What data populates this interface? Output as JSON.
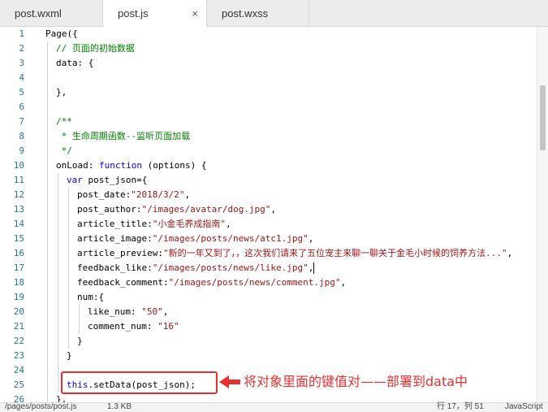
{
  "tabs": [
    {
      "label": "post.wxml"
    },
    {
      "label": "post.js",
      "active": true,
      "close": "×"
    },
    {
      "label": "post.wxss"
    }
  ],
  "code_lines": [
    {
      "n": "1",
      "indent": 0,
      "parts": [
        [
          "b",
          "Page({"
        ]
      ]
    },
    {
      "n": "2",
      "indent": 1,
      "parts": [
        [
          "c",
          "// 页面的初始数据"
        ]
      ]
    },
    {
      "n": "3",
      "indent": 1,
      "parts": [
        [
          "b",
          "data: {"
        ]
      ]
    },
    {
      "n": "4",
      "indent": 1,
      "parts": []
    },
    {
      "n": "5",
      "indent": 1,
      "parts": [
        [
          "b",
          "},"
        ]
      ]
    },
    {
      "n": "6",
      "indent": 1,
      "parts": []
    },
    {
      "n": "7",
      "indent": 1,
      "parts": [
        [
          "c",
          "/**"
        ]
      ]
    },
    {
      "n": "8",
      "indent": 1,
      "parts": [
        [
          "c",
          " * 生命周期函数--监听页面加载"
        ]
      ]
    },
    {
      "n": "9",
      "indent": 1,
      "parts": [
        [
          "c",
          " */"
        ]
      ]
    },
    {
      "n": "10",
      "indent": 1,
      "parts": [
        [
          "b",
          "onLoad: "
        ],
        [
          "k",
          "function"
        ],
        [
          "b",
          " (options) {"
        ]
      ]
    },
    {
      "n": "11",
      "indent": 2,
      "parts": [
        [
          "k",
          "var"
        ],
        [
          "b",
          " post_json={"
        ]
      ]
    },
    {
      "n": "12",
      "indent": 3,
      "parts": [
        [
          "b",
          "post_date:"
        ],
        [
          "s",
          "\"2018/3/2\""
        ],
        [
          "b",
          ","
        ]
      ]
    },
    {
      "n": "13",
      "indent": 3,
      "parts": [
        [
          "b",
          "post_author:"
        ],
        [
          "s",
          "\"/images/avatar/dog.jpg\""
        ],
        [
          "b",
          ","
        ]
      ]
    },
    {
      "n": "14",
      "indent": 3,
      "parts": [
        [
          "b",
          "article_title:"
        ],
        [
          "s",
          "\"小金毛养成指南\""
        ],
        [
          "b",
          ","
        ]
      ]
    },
    {
      "n": "15",
      "indent": 3,
      "parts": [
        [
          "b",
          "article_image:"
        ],
        [
          "s",
          "\"/images/posts/news/atc1.jpg\""
        ],
        [
          "b",
          ","
        ]
      ]
    },
    {
      "n": "16",
      "indent": 3,
      "parts": [
        [
          "b",
          "article_preview:"
        ],
        [
          "s",
          "\"新的一年又到了，，这次我们请来了五位宠主来聊一聊关于金毛小时候的饲养方法...\""
        ],
        [
          "b",
          ","
        ]
      ]
    },
    {
      "n": "17",
      "indent": 3,
      "parts": [
        [
          "b",
          "feedback_like:"
        ],
        [
          "s",
          "\"/images/posts/news/like.jpg\""
        ],
        [
          "b",
          ","
        ]
      ],
      "cursor": true
    },
    {
      "n": "18",
      "indent": 3,
      "parts": [
        [
          "b",
          "feedback_comment:"
        ],
        [
          "s",
          "\"/images/posts/news/comment.jpg\""
        ],
        [
          "b",
          ","
        ]
      ]
    },
    {
      "n": "19",
      "indent": 3,
      "parts": [
        [
          "b",
          "num:{"
        ]
      ]
    },
    {
      "n": "20",
      "indent": 4,
      "parts": [
        [
          "b",
          "like_num: "
        ],
        [
          "s",
          "\"50\""
        ],
        [
          "b",
          ","
        ]
      ]
    },
    {
      "n": "21",
      "indent": 4,
      "parts": [
        [
          "b",
          "comment_num: "
        ],
        [
          "s",
          "\"16\""
        ]
      ]
    },
    {
      "n": "22",
      "indent": 3,
      "parts": [
        [
          "b",
          "}"
        ]
      ]
    },
    {
      "n": "23",
      "indent": 2,
      "parts": [
        [
          "b",
          "}"
        ]
      ]
    },
    {
      "n": "24",
      "indent": 2,
      "parts": []
    },
    {
      "n": "25",
      "indent": 2,
      "parts": [
        [
          "k",
          "this"
        ],
        [
          "b",
          ".setData(post_json);"
        ]
      ]
    },
    {
      "n": "26",
      "indent": 1,
      "parts": [
        [
          "b",
          "},"
        ]
      ]
    }
  ],
  "annotation": {
    "text": "将对象里面的键值对——部署到data中",
    "color": "#e53030"
  },
  "status": {
    "path": "/pages/posts/post.js",
    "size": "1.3 KB",
    "position": "行 17，列 51",
    "language": "JavaScript"
  },
  "colors": {
    "comment": "#008000",
    "keyword": "#0000ff",
    "string": "#a31515",
    "line_number": "#237893"
  }
}
